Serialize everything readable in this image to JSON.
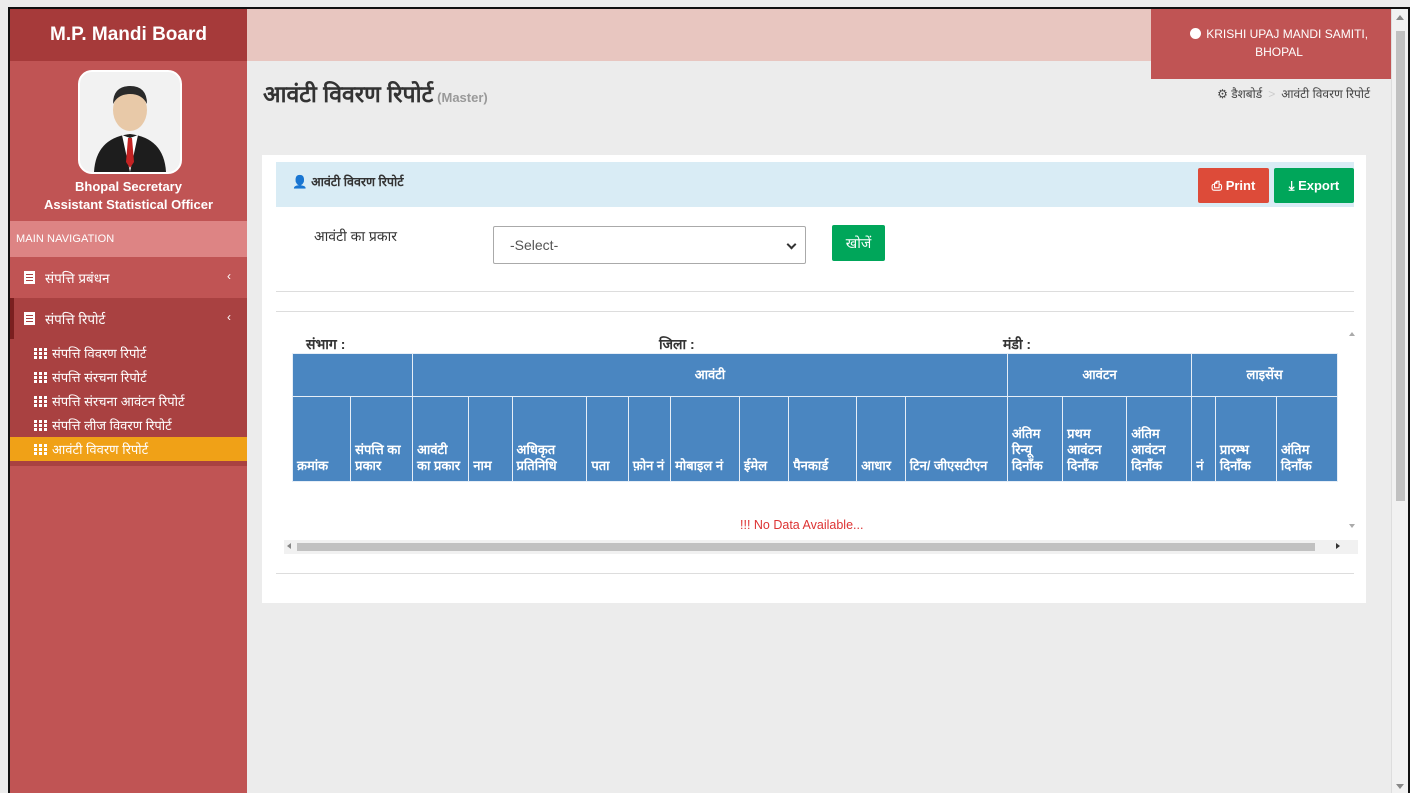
{
  "brand": "M.P. Mandi Board",
  "user": {
    "name": "Bhopal Secretary",
    "role": "Assistant Statistical Officer"
  },
  "nav": {
    "header": "MAIN NAVIGATION",
    "items": [
      {
        "label": "संपत्ति प्रबंधन",
        "chevron": "‹"
      },
      {
        "label": "संपत्ति रिपोर्ट",
        "chevron": "‹"
      }
    ],
    "subitems": [
      "संपत्ति विवरण रिपोर्ट",
      "संपत्ति संरचना रिपोर्ट",
      "संपत्ति संरचना आवंटन रिपोर्ट",
      "संपत्ति लीज विवरण रिपोर्ट",
      "आवंटी विवरण रिपोर्ट"
    ]
  },
  "topbar": {
    "org_line1": "KRISHI UPAJ MANDI SAMITI,",
    "org_line2": "BHOPAL",
    "logout_icon": "sign-out-icon"
  },
  "page": {
    "title": "आवंटी विवरण रिपोर्ट",
    "subtitle": "(Master)"
  },
  "breadcrumb": {
    "home": "डैशबोर्ड",
    "current": "आवंटी विवरण रिपोर्ट"
  },
  "panel": {
    "title": "आवंटी विवरण रिपोर्ट",
    "print": "Print",
    "export": "Export",
    "filter_label": "आवंटी का प्रकार",
    "select_value": "-Select-",
    "search": "खोजें"
  },
  "region": {
    "division": "संभाग :",
    "district": "जिला :",
    "mandi": "मंडी :"
  },
  "table": {
    "groups": [
      "आवंटी",
      "आवंटन",
      "लाइसेंस"
    ],
    "columns": [
      "क्रमांक",
      "संपत्ति का प्रकार",
      "आवंटी का प्रकार",
      "नाम",
      "अधिकृत प्रतिनिधि",
      "पता",
      "फ़ोन नं",
      "मोबाइल नं",
      "ईमेल",
      "पैनकार्ड",
      "आधार",
      "टिन/ जीएसटीएन",
      "अंतिम रिन्यू दिनाँक",
      "प्रथम आवंटन दिनाँक",
      "अंतिम आवंटन दिनाँक",
      "नं",
      "प्रारम्भ दिनाँक",
      "अंतिम दिनाँक"
    ],
    "empty_message": "!!! No Data Available..."
  }
}
